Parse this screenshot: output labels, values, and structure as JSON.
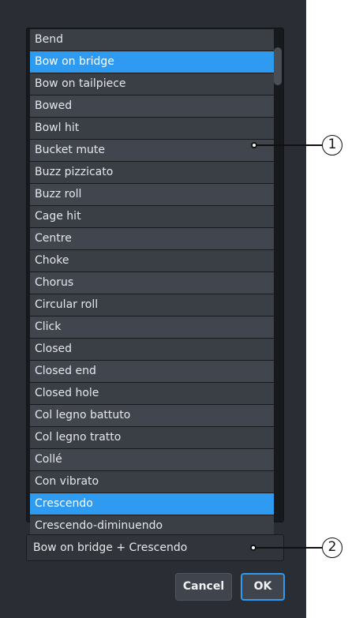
{
  "list": {
    "items": [
      {
        "label": "Bend",
        "selected": false
      },
      {
        "label": "Bow on bridge",
        "selected": true
      },
      {
        "label": "Bow on tailpiece",
        "selected": false
      },
      {
        "label": "Bowed",
        "selected": false
      },
      {
        "label": "Bowl hit",
        "selected": false
      },
      {
        "label": "Bucket mute",
        "selected": false
      },
      {
        "label": "Buzz pizzicato",
        "selected": false
      },
      {
        "label": "Buzz roll",
        "selected": false
      },
      {
        "label": "Cage hit",
        "selected": false
      },
      {
        "label": "Centre",
        "selected": false
      },
      {
        "label": "Choke",
        "selected": false
      },
      {
        "label": "Chorus",
        "selected": false
      },
      {
        "label": "Circular roll",
        "selected": false
      },
      {
        "label": "Click",
        "selected": false
      },
      {
        "label": "Closed",
        "selected": false
      },
      {
        "label": "Closed end",
        "selected": false
      },
      {
        "label": "Closed hole",
        "selected": false
      },
      {
        "label": "Col legno battuto",
        "selected": false
      },
      {
        "label": "Col legno tratto",
        "selected": false
      },
      {
        "label": "Collé",
        "selected": false
      },
      {
        "label": "Con vibrato",
        "selected": false
      },
      {
        "label": "Crescendo",
        "selected": true
      },
      {
        "label": "Crescendo-diminuendo",
        "selected": false
      }
    ]
  },
  "result": {
    "value": "Bow on bridge + Crescendo"
  },
  "buttons": {
    "cancel_label": "Cancel",
    "ok_label": "OK"
  },
  "callouts": {
    "one": "1",
    "two": "2"
  },
  "colors": {
    "selection": "#2f9bf0",
    "dialog_background": "#2a2d33"
  }
}
